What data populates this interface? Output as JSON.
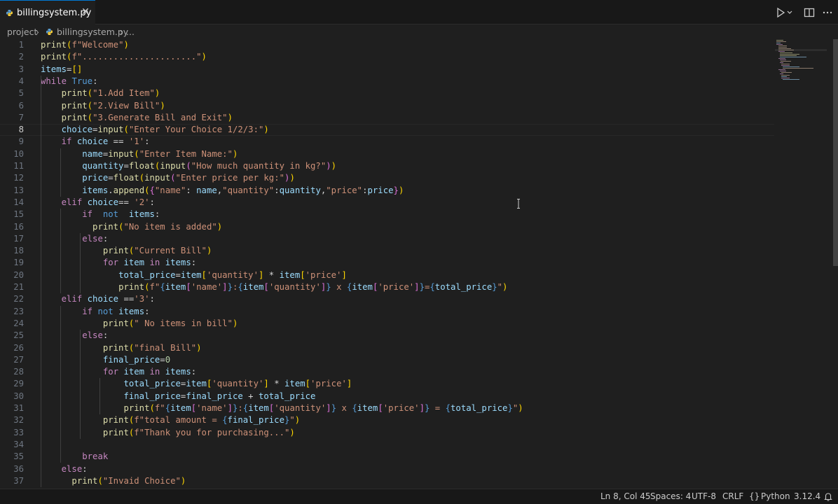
{
  "tab": {
    "filename": "billingsystem.py",
    "icon": "python-file-icon",
    "close_icon": "close-icon"
  },
  "breadcrumb": {
    "folder": "project",
    "file": "billingsystem.py",
    "more": "..."
  },
  "editor": {
    "current_line": 8,
    "lines": [
      [
        [
          "fn",
          "print"
        ],
        [
          "b1",
          "("
        ],
        [
          "str",
          "f\"Welcome\""
        ],
        [
          "b1",
          ")"
        ]
      ],
      [
        [
          "fn",
          "print"
        ],
        [
          "b1",
          "("
        ],
        [
          "str",
          "f\"......................\""
        ],
        [
          "b1",
          ")"
        ]
      ],
      [
        [
          "var",
          "items"
        ],
        [
          "op",
          "="
        ],
        [
          "b1",
          "[]"
        ]
      ],
      [
        [
          "kw",
          "while"
        ],
        [
          "op",
          " "
        ],
        [
          "bl",
          "True"
        ],
        [
          "op",
          ":"
        ]
      ],
      [
        [
          "op",
          "    "
        ],
        [
          "fn",
          "print"
        ],
        [
          "b1",
          "("
        ],
        [
          "str",
          "\"1.Add Item\""
        ],
        [
          "b1",
          ")"
        ]
      ],
      [
        [
          "op",
          "    "
        ],
        [
          "fn",
          "print"
        ],
        [
          "b1",
          "("
        ],
        [
          "str",
          "\"2.View Bill\""
        ],
        [
          "b1",
          ")"
        ]
      ],
      [
        [
          "op",
          "    "
        ],
        [
          "fn",
          "print"
        ],
        [
          "b1",
          "("
        ],
        [
          "str",
          "\"3.Generate Bill and Exit\""
        ],
        [
          "b1",
          ")"
        ]
      ],
      [
        [
          "op",
          "    "
        ],
        [
          "var",
          "choice"
        ],
        [
          "op",
          "="
        ],
        [
          "fn",
          "input"
        ],
        [
          "b1",
          "("
        ],
        [
          "str",
          "\"Enter Your Choice 1/2/3:\""
        ],
        [
          "b1",
          ")"
        ]
      ],
      [
        [
          "op",
          "    "
        ],
        [
          "kw",
          "if"
        ],
        [
          "op",
          " "
        ],
        [
          "var",
          "choice"
        ],
        [
          "op",
          " == "
        ],
        [
          "str",
          "'1'"
        ],
        [
          "op",
          ":"
        ]
      ],
      [
        [
          "op",
          "        "
        ],
        [
          "var",
          "name"
        ],
        [
          "op",
          "="
        ],
        [
          "fn",
          "input"
        ],
        [
          "b1",
          "("
        ],
        [
          "str",
          "\"Enter Item Name:\""
        ],
        [
          "b1",
          ")"
        ]
      ],
      [
        [
          "op",
          "        "
        ],
        [
          "var",
          "quantity"
        ],
        [
          "op",
          "="
        ],
        [
          "fn",
          "float"
        ],
        [
          "b1",
          "("
        ],
        [
          "fn",
          "input"
        ],
        [
          "b2",
          "("
        ],
        [
          "str",
          "\"How much quantity in kg?\""
        ],
        [
          "b2",
          ")"
        ],
        [
          "b1",
          ")"
        ]
      ],
      [
        [
          "op",
          "        "
        ],
        [
          "var",
          "price"
        ],
        [
          "op",
          "="
        ],
        [
          "fn",
          "float"
        ],
        [
          "b1",
          "("
        ],
        [
          "fn",
          "input"
        ],
        [
          "b2",
          "("
        ],
        [
          "str",
          "\"Enter price per kg:\""
        ],
        [
          "b2",
          ")"
        ],
        [
          "b1",
          ")"
        ]
      ],
      [
        [
          "op",
          "        "
        ],
        [
          "var",
          "items"
        ],
        [
          "op",
          "."
        ],
        [
          "fn",
          "append"
        ],
        [
          "b1",
          "("
        ],
        [
          "b2",
          "{"
        ],
        [
          "str",
          "\"name\""
        ],
        [
          "op",
          ": "
        ],
        [
          "var",
          "name"
        ],
        [
          "op",
          ","
        ],
        [
          "str",
          "\"quantity\""
        ],
        [
          "op",
          ":"
        ],
        [
          "var",
          "quantity"
        ],
        [
          "op",
          ","
        ],
        [
          "str",
          "\"price\""
        ],
        [
          "op",
          ":"
        ],
        [
          "var",
          "price"
        ],
        [
          "b2",
          "}"
        ],
        [
          "b1",
          ")"
        ]
      ],
      [
        [
          "op",
          "    "
        ],
        [
          "kw",
          "elif"
        ],
        [
          "op",
          " "
        ],
        [
          "var",
          "choice"
        ],
        [
          "op",
          "== "
        ],
        [
          "str",
          "'2'"
        ],
        [
          "op",
          ":"
        ]
      ],
      [
        [
          "op",
          "        "
        ],
        [
          "kw",
          "if"
        ],
        [
          "op",
          "  "
        ],
        [
          "bl",
          "not"
        ],
        [
          "op",
          "  "
        ],
        [
          "var",
          "items"
        ],
        [
          "op",
          ":"
        ]
      ],
      [
        [
          "op",
          "          "
        ],
        [
          "fn",
          "print"
        ],
        [
          "b1",
          "("
        ],
        [
          "str",
          "\"No item is added\""
        ],
        [
          "b1",
          ")"
        ]
      ],
      [
        [
          "op",
          "        "
        ],
        [
          "kw",
          "else"
        ],
        [
          "op",
          ":"
        ]
      ],
      [
        [
          "op",
          "            "
        ],
        [
          "fn",
          "print"
        ],
        [
          "b1",
          "("
        ],
        [
          "str",
          "\"Current Bill\""
        ],
        [
          "b1",
          ")"
        ]
      ],
      [
        [
          "op",
          "            "
        ],
        [
          "kw",
          "for"
        ],
        [
          "op",
          " "
        ],
        [
          "var",
          "item"
        ],
        [
          "op",
          " "
        ],
        [
          "kw",
          "in"
        ],
        [
          "op",
          " "
        ],
        [
          "var",
          "items"
        ],
        [
          "op",
          ":"
        ]
      ],
      [
        [
          "op",
          "               "
        ],
        [
          "var",
          "total_price"
        ],
        [
          "op",
          "="
        ],
        [
          "var",
          "item"
        ],
        [
          "b1",
          "["
        ],
        [
          "str",
          "'quantity'"
        ],
        [
          "b1",
          "]"
        ],
        [
          "op",
          " * "
        ],
        [
          "var",
          "item"
        ],
        [
          "b1",
          "["
        ],
        [
          "str",
          "'price'"
        ],
        [
          "b1",
          "]"
        ]
      ],
      [
        [
          "op",
          "               "
        ],
        [
          "fn",
          "print"
        ],
        [
          "b1",
          "("
        ],
        [
          "str",
          "f\""
        ],
        [
          "bl",
          "{"
        ],
        [
          "var",
          "item"
        ],
        [
          "b2",
          "["
        ],
        [
          "str",
          "'name'"
        ],
        [
          "b2",
          "]"
        ],
        [
          "bl",
          "}"
        ],
        [
          "str",
          ":"
        ],
        [
          "bl",
          "{"
        ],
        [
          "var",
          "item"
        ],
        [
          "b2",
          "["
        ],
        [
          "str",
          "'quantity'"
        ],
        [
          "b2",
          "]"
        ],
        [
          "bl",
          "}"
        ],
        [
          "str",
          " x "
        ],
        [
          "bl",
          "{"
        ],
        [
          "var",
          "item"
        ],
        [
          "b2",
          "["
        ],
        [
          "str",
          "'price'"
        ],
        [
          "b2",
          "]"
        ],
        [
          "bl",
          "}"
        ],
        [
          "str",
          "="
        ],
        [
          "bl",
          "{"
        ],
        [
          "var",
          "total_price"
        ],
        [
          "bl",
          "}"
        ],
        [
          "str",
          "\""
        ],
        [
          "b1",
          ")"
        ]
      ],
      [
        [
          "op",
          "    "
        ],
        [
          "kw",
          "elif"
        ],
        [
          "op",
          " "
        ],
        [
          "var",
          "choice"
        ],
        [
          "op",
          " =="
        ],
        [
          "str",
          "'3'"
        ],
        [
          "op",
          ":"
        ]
      ],
      [
        [
          "op",
          "        "
        ],
        [
          "kw",
          "if"
        ],
        [
          "op",
          " "
        ],
        [
          "bl",
          "not"
        ],
        [
          "op",
          " "
        ],
        [
          "var",
          "items"
        ],
        [
          "op",
          ":"
        ]
      ],
      [
        [
          "op",
          "            "
        ],
        [
          "fn",
          "print"
        ],
        [
          "b1",
          "("
        ],
        [
          "str",
          "\" No items in bill\""
        ],
        [
          "b1",
          ")"
        ]
      ],
      [
        [
          "op",
          "        "
        ],
        [
          "kw",
          "else"
        ],
        [
          "op",
          ":"
        ]
      ],
      [
        [
          "op",
          "            "
        ],
        [
          "fn",
          "print"
        ],
        [
          "b1",
          "("
        ],
        [
          "str",
          "\"final Bill\""
        ],
        [
          "b1",
          ")"
        ]
      ],
      [
        [
          "op",
          "            "
        ],
        [
          "var",
          "final_price"
        ],
        [
          "op",
          "="
        ],
        [
          "num",
          "0"
        ]
      ],
      [
        [
          "op",
          "            "
        ],
        [
          "kw",
          "for"
        ],
        [
          "op",
          " "
        ],
        [
          "var",
          "item"
        ],
        [
          "op",
          " "
        ],
        [
          "kw",
          "in"
        ],
        [
          "op",
          " "
        ],
        [
          "var",
          "items"
        ],
        [
          "op",
          ":"
        ]
      ],
      [
        [
          "op",
          "                "
        ],
        [
          "var",
          "total_price"
        ],
        [
          "op",
          "="
        ],
        [
          "var",
          "item"
        ],
        [
          "b1",
          "["
        ],
        [
          "str",
          "'quantity'"
        ],
        [
          "b1",
          "]"
        ],
        [
          "op",
          " * "
        ],
        [
          "var",
          "item"
        ],
        [
          "b1",
          "["
        ],
        [
          "str",
          "'price'"
        ],
        [
          "b1",
          "]"
        ]
      ],
      [
        [
          "op",
          "                "
        ],
        [
          "var",
          "final_price"
        ],
        [
          "op",
          "="
        ],
        [
          "var",
          "final_price"
        ],
        [
          "op",
          " + "
        ],
        [
          "var",
          "total_price"
        ]
      ],
      [
        [
          "op",
          "                "
        ],
        [
          "fn",
          "print"
        ],
        [
          "b1",
          "("
        ],
        [
          "str",
          "f\""
        ],
        [
          "bl",
          "{"
        ],
        [
          "var",
          "item"
        ],
        [
          "b2",
          "["
        ],
        [
          "str",
          "'name'"
        ],
        [
          "b2",
          "]"
        ],
        [
          "bl",
          "}"
        ],
        [
          "str",
          ":"
        ],
        [
          "bl",
          "{"
        ],
        [
          "var",
          "item"
        ],
        [
          "b2",
          "["
        ],
        [
          "str",
          "'quantity'"
        ],
        [
          "b2",
          "]"
        ],
        [
          "bl",
          "}"
        ],
        [
          "str",
          " x "
        ],
        [
          "bl",
          "{"
        ],
        [
          "var",
          "item"
        ],
        [
          "b2",
          "["
        ],
        [
          "str",
          "'price'"
        ],
        [
          "b2",
          "]"
        ],
        [
          "bl",
          "}"
        ],
        [
          "str",
          " = "
        ],
        [
          "bl",
          "{"
        ],
        [
          "var",
          "total_price"
        ],
        [
          "bl",
          "}"
        ],
        [
          "str",
          "\""
        ],
        [
          "b1",
          ")"
        ]
      ],
      [
        [
          "op",
          "            "
        ],
        [
          "fn",
          "print"
        ],
        [
          "b1",
          "("
        ],
        [
          "str",
          "f\"total amount = "
        ],
        [
          "bl",
          "{"
        ],
        [
          "var",
          "final_price"
        ],
        [
          "bl",
          "}"
        ],
        [
          "str",
          "\""
        ],
        [
          "b1",
          ")"
        ]
      ],
      [
        [
          "op",
          "            "
        ],
        [
          "fn",
          "print"
        ],
        [
          "b1",
          "("
        ],
        [
          "str",
          "f\"Thank you for purchasing...\""
        ],
        [
          "b1",
          ")"
        ]
      ],
      [],
      [
        [
          "op",
          "        "
        ],
        [
          "kw",
          "break"
        ]
      ],
      [
        [
          "op",
          "    "
        ],
        [
          "kw",
          "else"
        ],
        [
          "op",
          ":"
        ]
      ],
      [
        [
          "op",
          "      "
        ],
        [
          "fn",
          "print"
        ],
        [
          "b1",
          "("
        ],
        [
          "str",
          "\"Invaid Choice\""
        ],
        [
          "b1",
          ")"
        ]
      ]
    ]
  },
  "statusbar": {
    "position": "Ln 8, Col 45",
    "spaces": "Spaces: 4",
    "encoding": "UTF-8",
    "eol": "CRLF",
    "language": "Python",
    "language_icon": "braces-icon",
    "version": "3.12.4",
    "bell_icon": "bell-icon"
  },
  "colors": {
    "background": "#1f1f1f",
    "function": "#dcdcaa",
    "string": "#ce9178",
    "keyword": "#c586c0",
    "builtin": "#569cd6",
    "variable": "#9cdcfe",
    "accent": "#0078d4"
  }
}
